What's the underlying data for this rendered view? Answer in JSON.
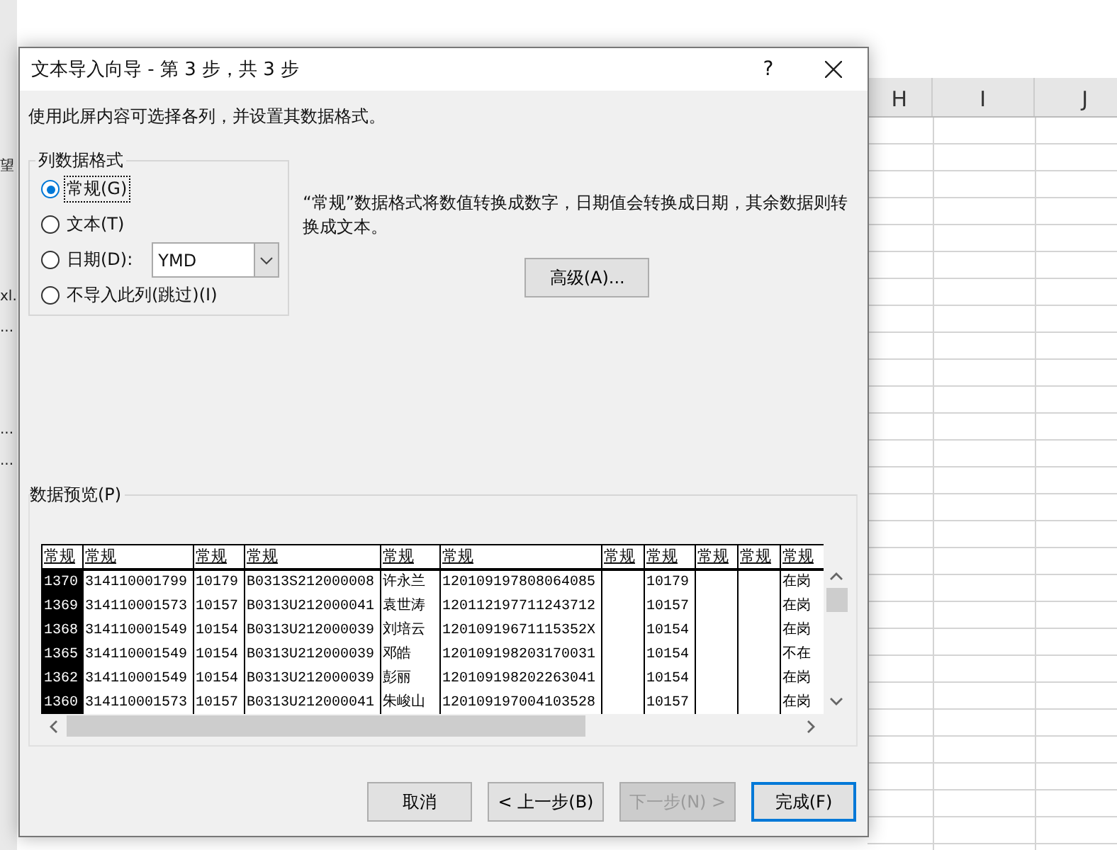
{
  "sheet": {
    "column_headers": [
      "H",
      "I",
      "J"
    ],
    "side_fragments": [
      "望",
      "xl.",
      "...",
      "...",
      "..."
    ]
  },
  "dialog": {
    "title": "文本导入向导 - 第 3 步，共 3 步",
    "help": "?",
    "instruction": "使用此屏内容可选择各列，并设置其数据格式。",
    "format_group": {
      "label": "列数据格式",
      "options": [
        {
          "kind": "plain",
          "label": "常规(G)",
          "selected": true
        },
        {
          "kind": "plain",
          "label": "文本(T)",
          "selected": false
        },
        {
          "kind": "date",
          "label": "日期(D):",
          "selected": false,
          "value": "YMD"
        },
        {
          "kind": "plain",
          "label": "不导入此列(跳过)(I)",
          "selected": false
        }
      ]
    },
    "description": "“常规”数据格式将数值转换成数字，日期值会转换成日期，其余数据则转换成文本。",
    "advanced_button": "高级(A)...",
    "preview": {
      "label": "数据预览(P)",
      "columns": [
        {
          "header": "常规",
          "selected": true
        },
        {
          "header": "常规",
          "selected": false
        },
        {
          "header": "常规",
          "selected": false
        },
        {
          "header": "常规",
          "selected": false
        },
        {
          "header": "常规",
          "selected": false
        },
        {
          "header": "常规",
          "selected": false
        },
        {
          "header": "常规",
          "selected": false
        },
        {
          "header": "常规",
          "selected": false
        },
        {
          "header": "常规",
          "selected": false
        },
        {
          "header": "常规",
          "selected": false
        },
        {
          "header": "常规",
          "selected": false
        }
      ],
      "rows": [
        [
          "1370",
          "314110001799",
          "10179",
          "B0313S212000008",
          "许永兰",
          "120109197808064085",
          null,
          "10179",
          null,
          null,
          "在岗"
        ],
        [
          "1369",
          "314110001573",
          "10157",
          "B0313U212000041",
          "袁世涛",
          "120112197711243712",
          null,
          "10157",
          null,
          null,
          "在岗"
        ],
        [
          "1368",
          "314110001549",
          "10154",
          "B0313U212000039",
          "刘培云",
          "12010919671115352X",
          null,
          "10154",
          null,
          null,
          "在岗"
        ],
        [
          "1365",
          "314110001549",
          "10154",
          "B0313U212000039",
          "邓皓",
          "120109198203170031",
          null,
          "10154",
          null,
          null,
          "不在"
        ],
        [
          "1362",
          "314110001549",
          "10154",
          "B0313U212000039",
          "彭丽",
          "120109198202263041",
          null,
          "10154",
          null,
          null,
          "在岗"
        ],
        [
          "1360",
          "314110001573",
          "10157",
          "B0313U212000041",
          "朱峻山",
          "120109197004103528",
          null,
          "10157",
          null,
          null,
          "在岗"
        ]
      ]
    },
    "buttons": [
      {
        "label": "取消",
        "disabled": false,
        "focused": false
      },
      {
        "label": "< 上一步(B)",
        "disabled": false,
        "focused": false
      },
      {
        "label": "下一步(N) >",
        "disabled": true,
        "focused": false
      },
      {
        "label": "完成(F)",
        "disabled": false,
        "focused": true
      }
    ]
  }
}
